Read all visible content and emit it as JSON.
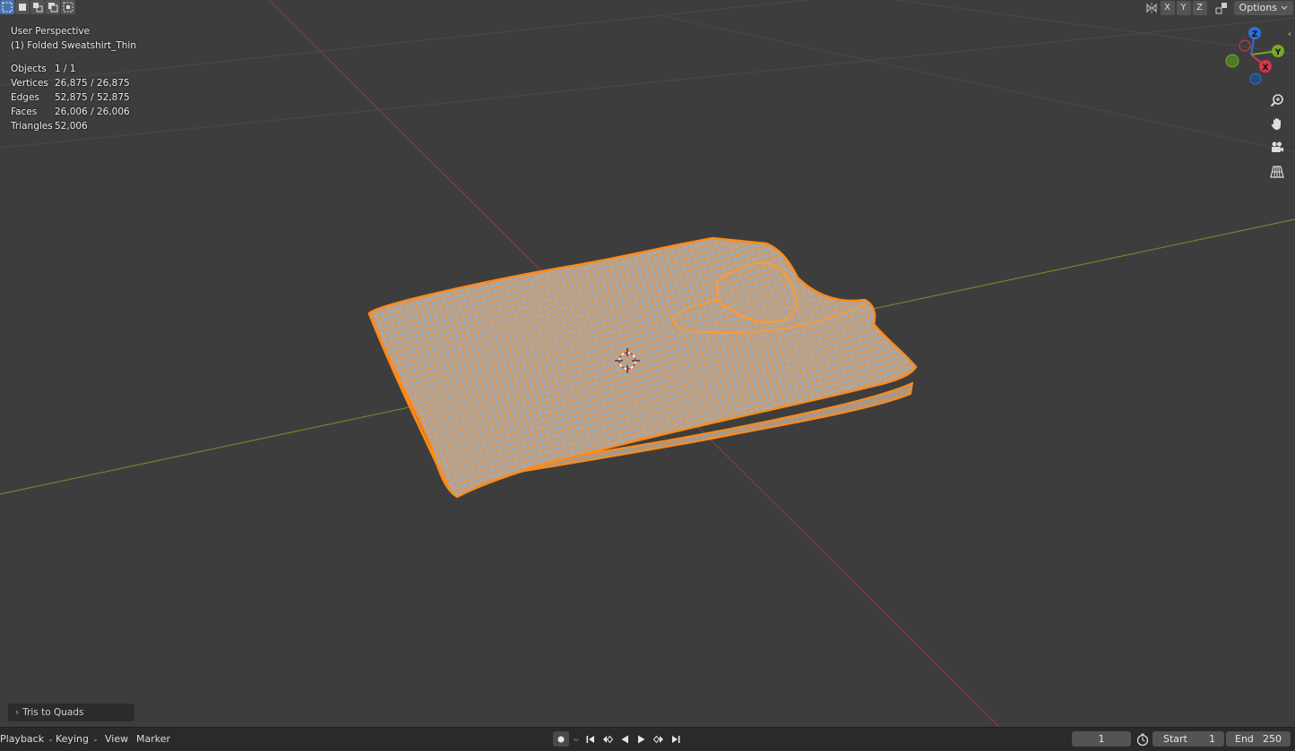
{
  "viewport": {
    "overlay": {
      "view_name": "User Perspective",
      "object_name": "(1) Folded  Sweatshirt_Thin",
      "stats": [
        {
          "label": "Objects",
          "value": "1 / 1"
        },
        {
          "label": "Vertices",
          "value": "26,875 / 26,875"
        },
        {
          "label": "Edges",
          "value": "52,875 / 52,875"
        },
        {
          "label": "Faces",
          "value": "26,006 / 26,006"
        },
        {
          "label": "Triangles",
          "value": "52,006"
        }
      ]
    },
    "header_right": {
      "mirror_axes": [
        "X",
        "Y",
        "Z"
      ],
      "options_label": "Options"
    },
    "gizmo_axes": {
      "x": "X",
      "y": "Y",
      "z": "Z"
    },
    "operator_panel": {
      "label": "Tris to Quads"
    },
    "colors": {
      "background": "#3d3d3d",
      "x_axis": "#8a3a46",
      "y_axis": "#6a8a2e",
      "selection": "#ff8c1a",
      "mesh": "#a3a3a3"
    }
  },
  "timeline": {
    "menus": [
      "Playback",
      "Keying",
      "View",
      "Marker"
    ],
    "current_frame": "1",
    "start_label": "Start",
    "start_value": "1",
    "end_label": "End",
    "end_value": "250"
  }
}
